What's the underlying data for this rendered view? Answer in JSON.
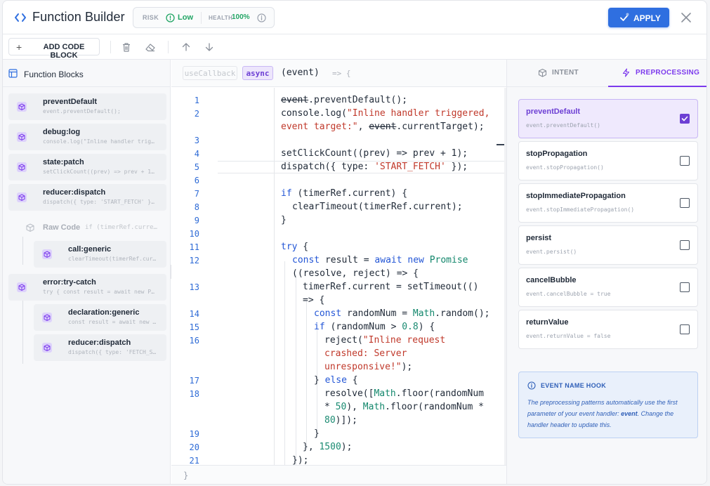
{
  "header": {
    "title": "Function Builder",
    "risk_label": "RISK",
    "risk_value": "Low",
    "health_label": "HEALTH",
    "health_value": "100%",
    "apply_label": "APPLY",
    "colors": {
      "accent": "#2f6fe0",
      "ok": "#22a565",
      "purple": "#7c3aed"
    }
  },
  "toolbar": {
    "add_label": "ADD CODE BLOCK",
    "icons": [
      "trash-icon",
      "eraser-icon",
      "arrow-up-icon",
      "arrow-down-icon"
    ]
  },
  "left": {
    "title": "Function Blocks",
    "blocks": [
      {
        "name": "preventDefault",
        "code": "event.preventDefault();"
      },
      {
        "name": "debug:log",
        "code": "console.log(\"Inline handler trig…"
      },
      {
        "name": "state:patch",
        "code": "setClickCount((prev) => prev + 1…"
      },
      {
        "name": "reducer:dispatch",
        "code": "dispatch({ type: 'START_FETCH' }…"
      },
      {
        "name": "Raw Code",
        "code": "if (timerRef.curre…"
      },
      {
        "name": "call:generic",
        "code": "clearTimeout(timerRef.cur…"
      },
      {
        "name": "error:try-catch",
        "code": "try { const result = await new P…"
      },
      {
        "name": "declaration:generic",
        "code": "const result = await new …"
      },
      {
        "name": "reducer:dispatch",
        "code": "dispatch({ type: 'FETCH_S…"
      }
    ]
  },
  "editor": {
    "chip_callback": "useCallback",
    "chip_async": "async",
    "param": "(event)",
    "arrow": "=> {",
    "line_numbers": [
      "1",
      "2",
      "3",
      "4",
      "5",
      "6",
      "7",
      "8",
      "9",
      "10",
      "11",
      "12",
      "13",
      "14",
      "15",
      "16",
      "17",
      "18",
      "19",
      "20",
      "21"
    ],
    "lines": {
      "l1a": "event",
      "l1b": ".preventDefault();",
      "l2a": "console.log(",
      "l2b": "\"Inline handler triggered,",
      "l2c": "event target:\"",
      "l2d": ", ",
      "l2e": "event",
      "l2f": ".currentTarget);",
      "l4": "setClickCount((prev) => prev + 1);",
      "l5a": "dispatch({ type: ",
      "l5b": "'START_FETCH'",
      "l5c": " });",
      "l7a": "if",
      "l7b": " (timerRef.current) {",
      "l8": "clearTimeout(timerRef.current);",
      "l9": "}",
      "l11a": "try",
      "l11b": " {",
      "l12a": "const",
      "l12b": " result = ",
      "l12c": "await new",
      "l12d": " Promise",
      "l12e": "((resolve, reject) => {",
      "l13a": "timerRef.current = setTimeout(()",
      "l13b": "=> {",
      "l14a": "const",
      "l14b": " randomNum = ",
      "l14c": "Math",
      "l14d": ".random();",
      "l15a": "if",
      "l15b": " (randomNum > ",
      "l15c": "0.8",
      "l15d": ") {",
      "l16a": "reject(",
      "l16b": "\"Inline request",
      "l16c": "crashed: Server",
      "l16d": "unresponsive!\"",
      "l16e": ");",
      "l17a": "} ",
      "l17b": "else",
      "l17c": " {",
      "l18a": "resolve([",
      "l18b": "Math",
      "l18c": ".floor(randomNum",
      "l18d": "* ",
      "l18e": "50",
      "l18f": "), ",
      "l18g": "Math",
      "l18h": ".floor(randomNum *",
      "l18i": "80",
      "l18j": ")]);",
      "l19": "}",
      "l20a": "}, ",
      "l20b": "1500",
      "l20c": ");",
      "l21": "});"
    },
    "footer": "}"
  },
  "right": {
    "tab_intent": "INTENT",
    "tab_pre": "PREPROCESSING",
    "options": [
      {
        "name": "preventDefault",
        "code": "event.preventDefault()",
        "checked": true
      },
      {
        "name": "stopPropagation",
        "code": "event.stopPropagation()",
        "checked": false
      },
      {
        "name": "stopImmediatePropagation",
        "code": "event.stopImmediatePropagation()",
        "checked": false
      },
      {
        "name": "persist",
        "code": "event.persist()",
        "checked": false
      },
      {
        "name": "cancelBubble",
        "code": "event.cancelBubble = true",
        "checked": false
      },
      {
        "name": "returnValue",
        "code": "event.returnValue = false",
        "checked": false
      }
    ],
    "hook_title": "EVENT NAME HOOK",
    "hook_text_a": "The preprocessing patterns automatically use the first parameter of your event handler: ",
    "hook_text_b": "event",
    "hook_text_c": ". Change the handler header to update this."
  }
}
